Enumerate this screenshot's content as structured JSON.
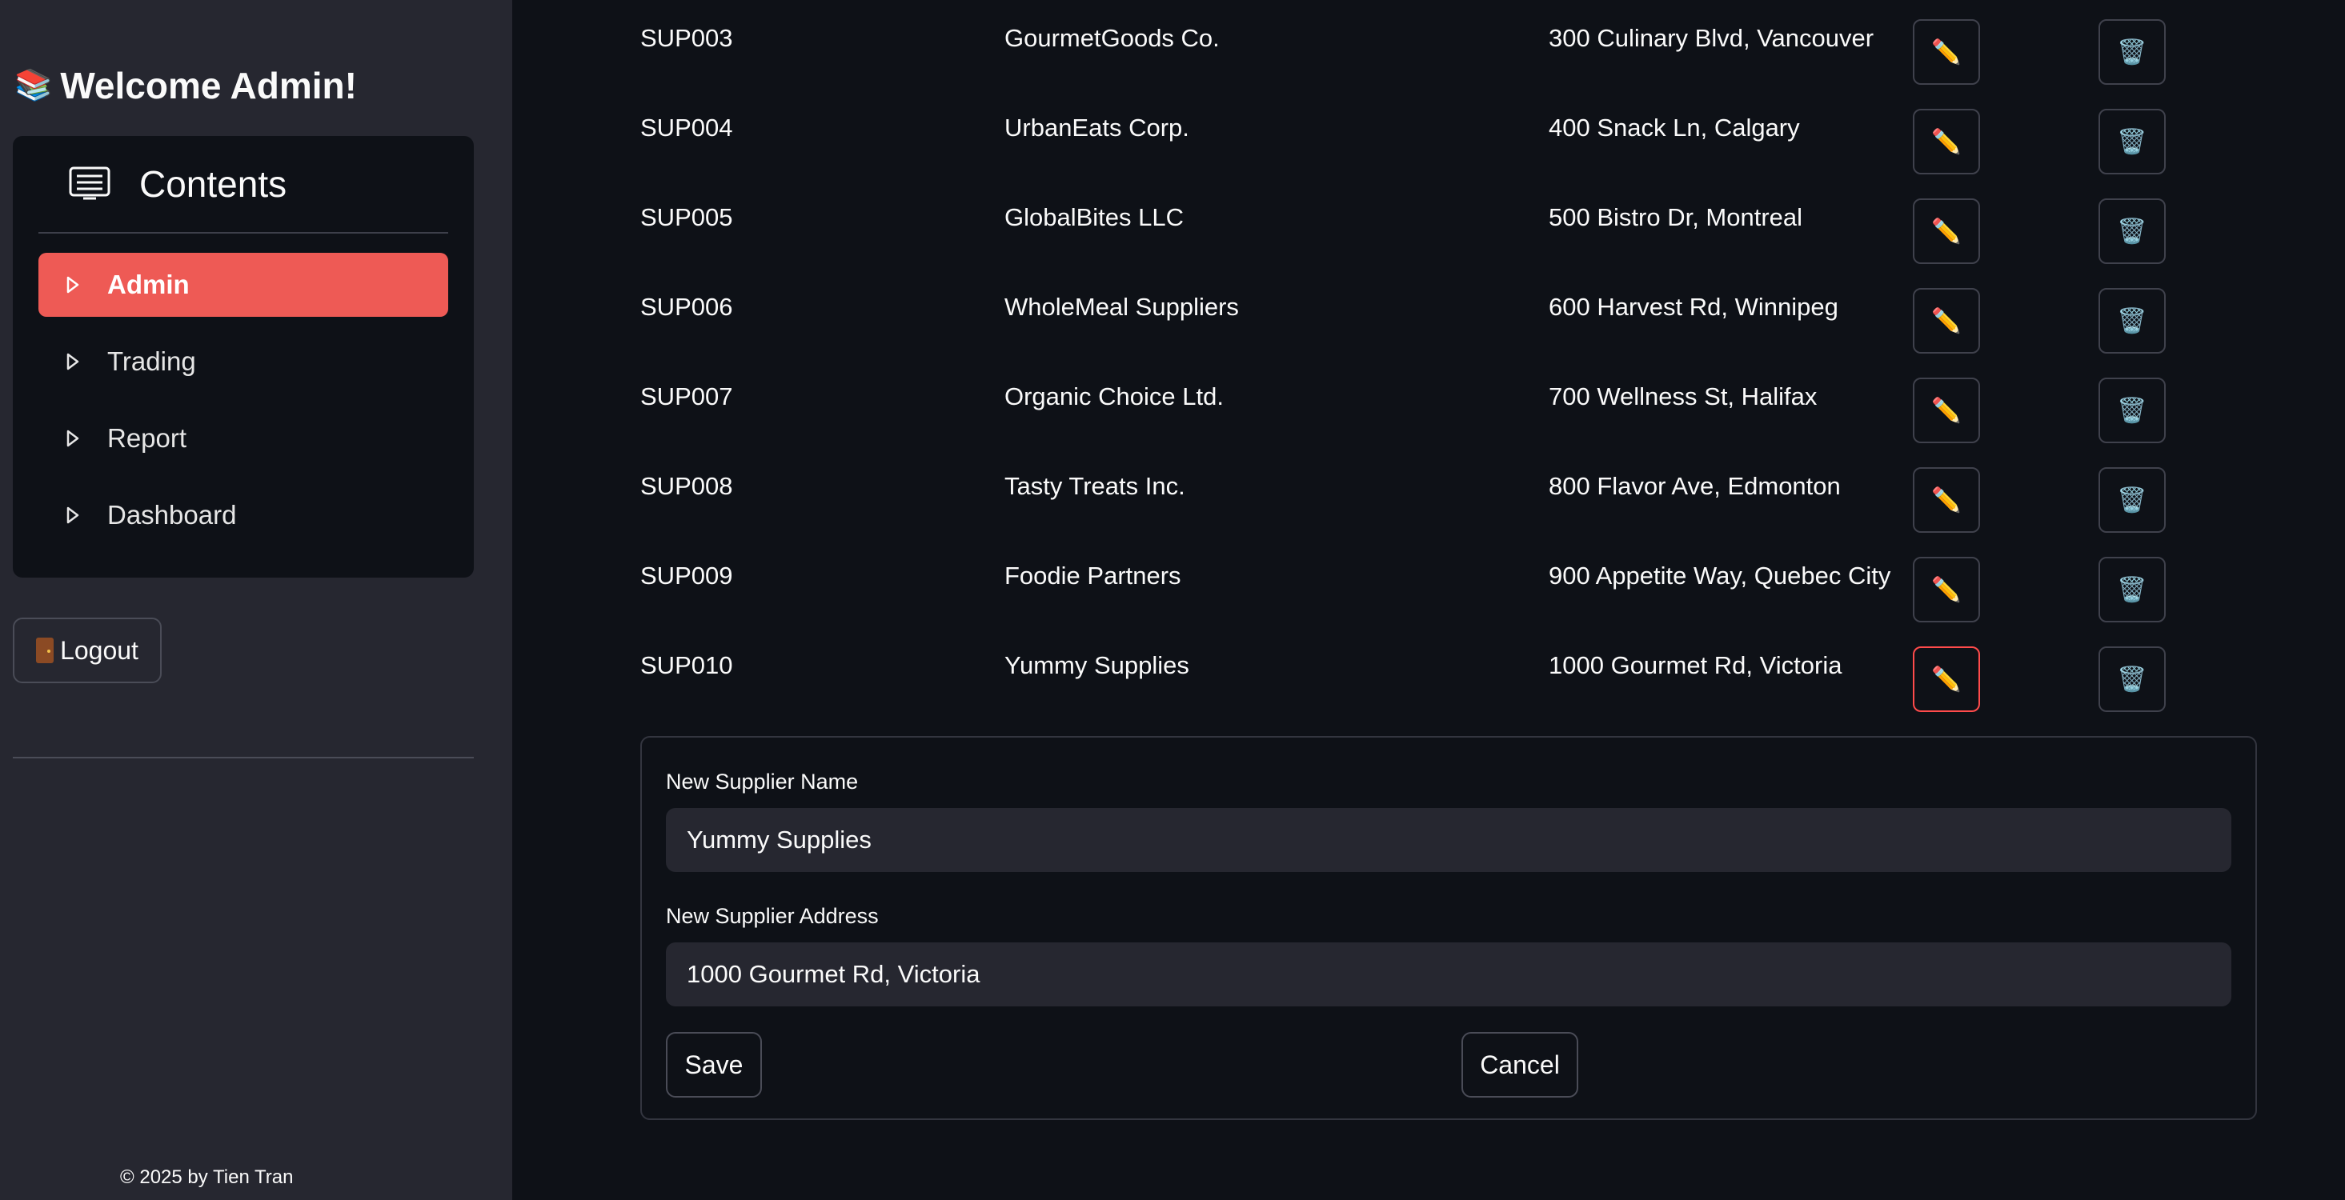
{
  "sidebar": {
    "welcome_emoji": "📚",
    "welcome_text": "Welcome Admin!",
    "menu_title": "Contents",
    "menu_icon": "contents-list-icon",
    "items": [
      {
        "label": "Admin",
        "active": true
      },
      {
        "label": "Trading",
        "active": false
      },
      {
        "label": "Report",
        "active": false
      },
      {
        "label": "Dashboard",
        "active": false
      }
    ],
    "logout_label": "Logout",
    "logout_icon": "door-icon",
    "footer": "© 2025 by Tien Tran"
  },
  "suppliers": [
    {
      "id": "SUP003",
      "name": "GourmetGoods Co.",
      "address": "300 Culinary Blvd, Vancouver"
    },
    {
      "id": "SUP004",
      "name": "UrbanEats Corp.",
      "address": "400 Snack Ln, Calgary"
    },
    {
      "id": "SUP005",
      "name": "GlobalBites LLC",
      "address": "500 Bistro Dr, Montreal"
    },
    {
      "id": "SUP006",
      "name": "WholeMeal Suppliers",
      "address": "600 Harvest Rd, Winnipeg"
    },
    {
      "id": "SUP007",
      "name": "Organic Choice Ltd.",
      "address": "700 Wellness St, Halifax"
    },
    {
      "id": "SUP008",
      "name": "Tasty Treats Inc.",
      "address": "800 Flavor Ave, Edmonton"
    },
    {
      "id": "SUP009",
      "name": "Foodie Partners",
      "address": "900 Appetite Way, Quebec City"
    },
    {
      "id": "SUP010",
      "name": "Yummy Supplies",
      "address": "1000 Gourmet Rd, Victoria"
    }
  ],
  "row_actions": {
    "edit_icon": "pencil-icon",
    "delete_icon": "trash-icon"
  },
  "edit_form": {
    "name_label": "New Supplier Name",
    "name_value": "Yummy Supplies",
    "address_label": "New Supplier Address",
    "address_value": "1000 Gourmet Rd, Victoria",
    "save_label": "Save",
    "cancel_label": "Cancel"
  },
  "colors": {
    "background": "#0e1117",
    "sidebar": "#262730",
    "accent": "#ee5a55",
    "focus_border": "#ff4b4b"
  }
}
